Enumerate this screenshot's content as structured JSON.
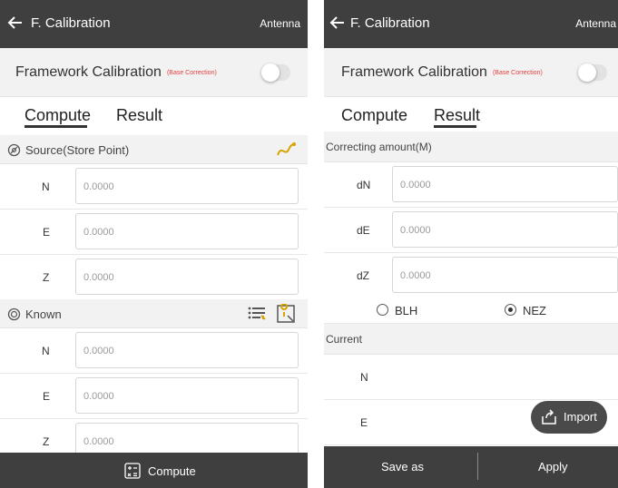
{
  "left": {
    "header": {
      "title": "F. Calibration",
      "right": "Antenna"
    },
    "framework": {
      "label": "Framework Calibration",
      "sub": "(Base Correction)"
    },
    "tabs": {
      "compute": "Compute",
      "result": "Result"
    },
    "source": {
      "title": "Source(Store Point)",
      "n_label": "N",
      "e_label": "E",
      "z_label": "Z",
      "n": "0.0000",
      "e": "0.0000",
      "z": "0.0000"
    },
    "known": {
      "title": "Known",
      "n_label": "N",
      "e_label": "E",
      "z_label": "Z",
      "n": "0.0000",
      "e": "0.0000",
      "z": "0.0000"
    },
    "bottom": {
      "compute": "Compute"
    }
  },
  "right": {
    "header": {
      "title": "F. Calibration",
      "right": "Antenna"
    },
    "framework": {
      "label": "Framework Calibration",
      "sub": "(Base Correction)"
    },
    "tabs": {
      "compute": "Compute",
      "result": "Result"
    },
    "correcting": {
      "title": "Correcting amount(M)",
      "dn_label": "dN",
      "de_label": "dE",
      "dz_label": "dZ",
      "dn": "0.0000",
      "de": "0.0000",
      "dz": "0.0000"
    },
    "radio": {
      "blh": "BLH",
      "nez": "NEZ",
      "selected": "NEZ"
    },
    "current": {
      "title": "Current",
      "n_label": "N",
      "e_label": "E"
    },
    "fab": {
      "label": "Import"
    },
    "bottom": {
      "save_as": "Save as",
      "apply": "Apply"
    }
  },
  "colors": {
    "bar": "#3f3f3f",
    "accent_red": "#e34040",
    "section": "#f2f2f2",
    "route_icon": "#d9a400"
  }
}
